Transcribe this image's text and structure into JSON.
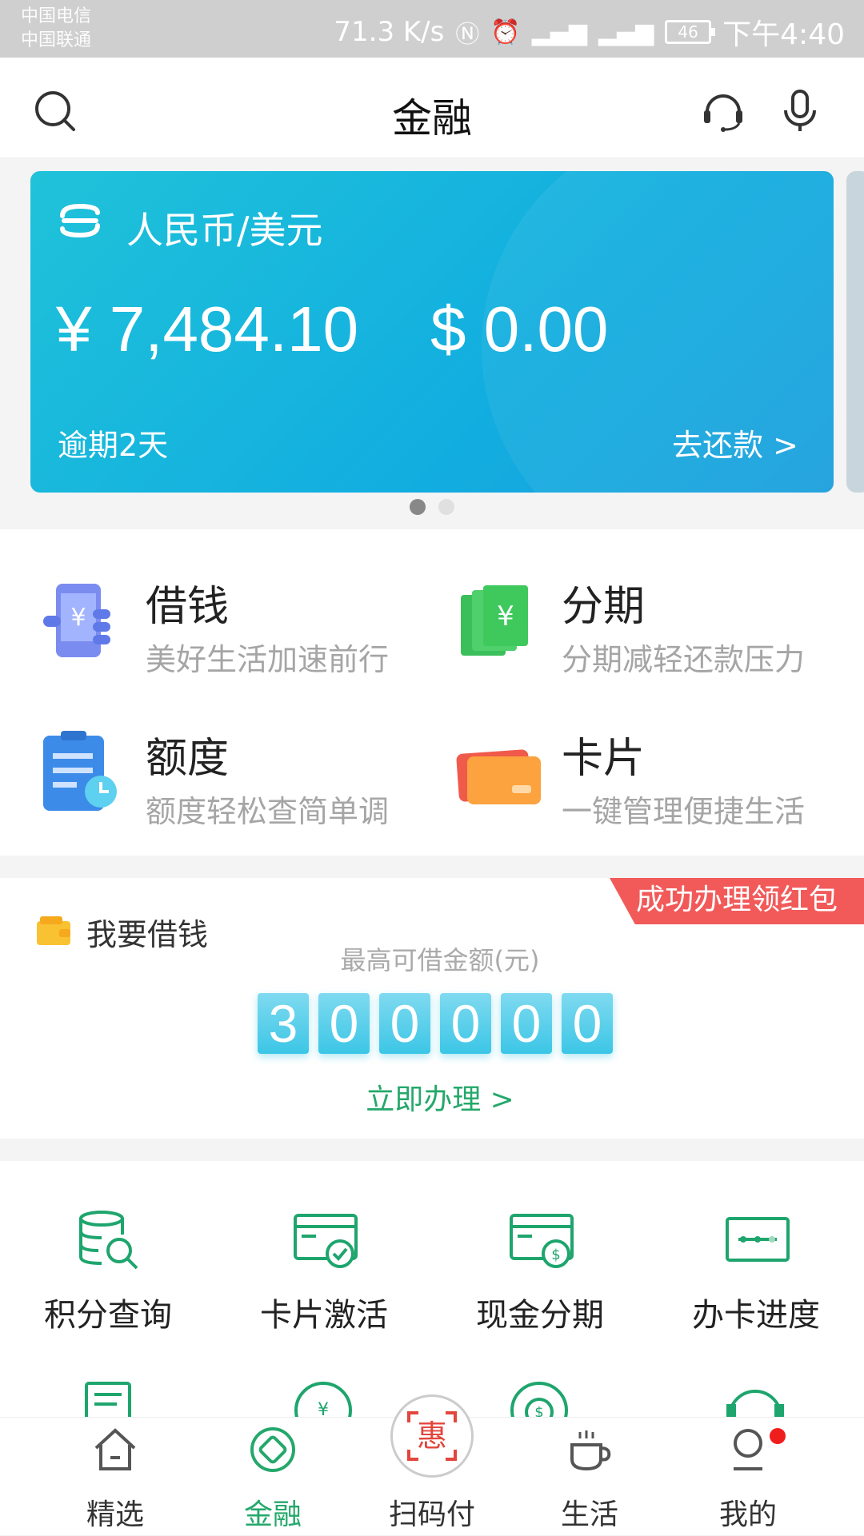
{
  "status_bar": {
    "carrier1": "中国电信",
    "carrier2": "中国联通",
    "speed": "71.3 K/s",
    "battery": "46",
    "time": "下午4:40"
  },
  "header": {
    "title": "金融"
  },
  "card": {
    "currency": "人民币/美元",
    "cny_amount": "¥ 7,484.10",
    "usd_amount": "$ 0.00",
    "overdue": "逾期2天",
    "repay": "去还款 >"
  },
  "services": [
    {
      "name": "借钱",
      "desc": "美好生活加速前行"
    },
    {
      "name": "分期",
      "desc": "分期减轻还款压力"
    },
    {
      "name": "额度",
      "desc": "额度轻松查简单调"
    },
    {
      "name": "卡片",
      "desc": "一键管理便捷生活"
    }
  ],
  "loan": {
    "ribbon": "成功办理领红包",
    "title": "我要借钱",
    "max_label": "最高可借金额(元)",
    "digits": [
      "3",
      "0",
      "0",
      "0",
      "0",
      "0"
    ],
    "apply": "立即办理 >"
  },
  "tools": [
    {
      "label": "积分查询",
      "icon": "database-search-icon"
    },
    {
      "label": "卡片激活",
      "icon": "card-check-icon"
    },
    {
      "label": "现金分期",
      "icon": "card-cash-icon"
    },
    {
      "label": "办卡进度",
      "icon": "progress-icon"
    }
  ],
  "tabs": [
    {
      "label": "精选",
      "icon": "home-icon"
    },
    {
      "label": "金融",
      "icon": "finance-icon",
      "active": true
    },
    {
      "label": "扫码付",
      "icon": "scan-hui-icon",
      "badge": "惠"
    },
    {
      "label": "生活",
      "icon": "cup-icon"
    },
    {
      "label": "我的",
      "icon": "user-icon"
    }
  ],
  "colors": {
    "accent_green": "#24a86b",
    "card_blue": "#12aee0",
    "ribbon_red": "#f25a5a"
  }
}
